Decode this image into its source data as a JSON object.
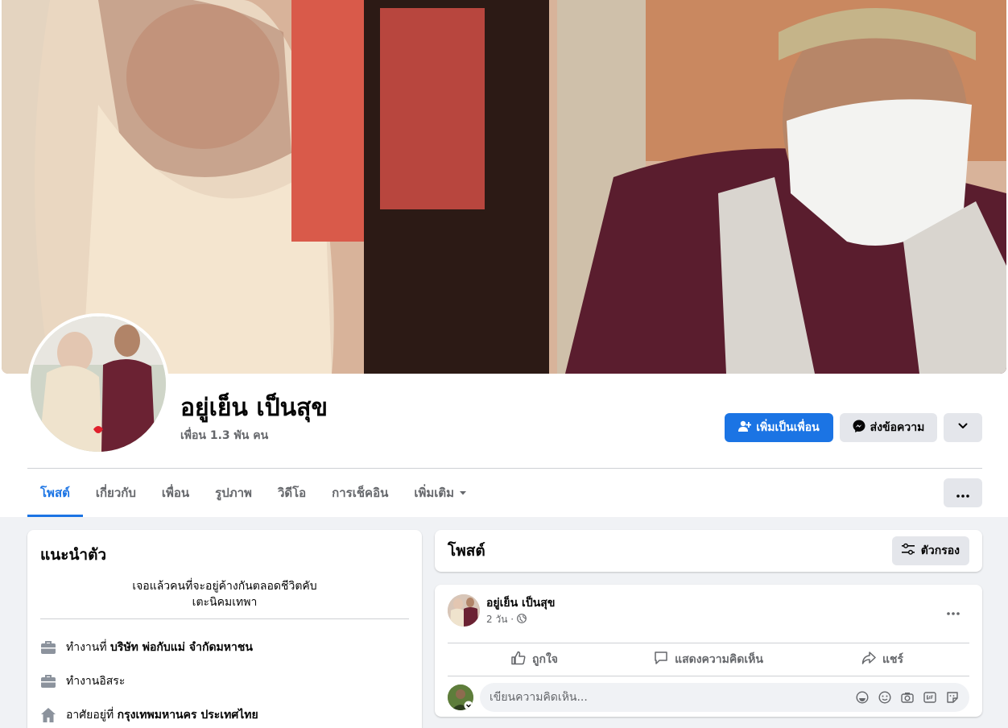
{
  "profile": {
    "name": "อยู่เย็น เป็นสุข",
    "friends": "เพื่อน 1.3 พัน คน"
  },
  "actions": {
    "add_friend": "เพิ่มเป็นเพื่อน",
    "message": "ส่งข้อความ"
  },
  "tabs": [
    {
      "label": "โพสต์"
    },
    {
      "label": "เกี่ยวกับ"
    },
    {
      "label": "เพื่อน"
    },
    {
      "label": "รูปภาพ"
    },
    {
      "label": "วิดีโอ"
    },
    {
      "label": "การเช็คอิน"
    },
    {
      "label": "เพิ่มเติม"
    }
  ],
  "intro": {
    "title": "แนะนำตัว",
    "bio_line1": "เจอแล้วคนที่จะอยู่ค้างกันตลอดชีวิตคับ",
    "bio_line2": "เตะนิคมเทพา",
    "work1_prefix": "ทำงานที่",
    "work1_company": "บริษัท พ่อกับแม่ จำกัดมหาชน",
    "work2": "ทำงานอิสระ",
    "lives_prefix": "อาศัยอยู่ที่",
    "lives_place": "กรุงเทพมหานคร ประเทศไทย"
  },
  "posts": {
    "title": "โพสต์",
    "filter_label": "ตัวกรอง"
  },
  "post": {
    "author": "อยู่เย็น เป็นสุข",
    "time": "2 วัน ·",
    "like": "ถูกใจ",
    "comment": "แสดงความคิดเห็น",
    "share": "แชร์",
    "comment_placeholder": "เขียนความคิดเห็น..."
  },
  "colors": {
    "accent": "#1b74e4",
    "background": "#f0f2f5"
  }
}
